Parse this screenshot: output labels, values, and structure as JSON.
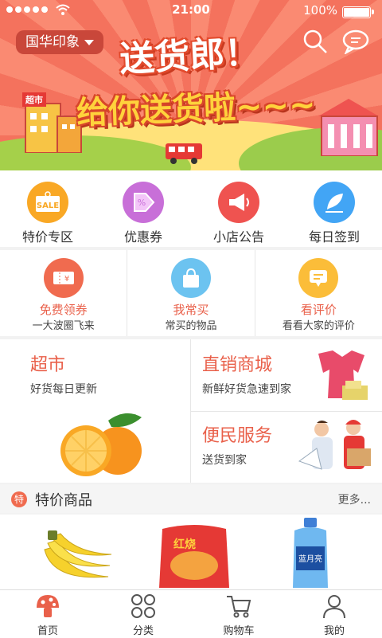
{
  "status_bar": {
    "time": "21:00",
    "battery": "100%"
  },
  "banner": {
    "location": "国华印象",
    "slogan_line1": "送货郎！",
    "slogan_line2": "给你送货啦~~~",
    "shop_sign": "超市"
  },
  "quick_nav": [
    {
      "label": "特价专区",
      "icon": "sale-tag-icon",
      "badge": "SALE",
      "color": "#f9a825"
    },
    {
      "label": "优惠券",
      "icon": "coupon-icon",
      "color": "#c86fd8"
    },
    {
      "label": "小店公告",
      "icon": "megaphone-icon",
      "color": "#ef5350"
    },
    {
      "label": "每日签到",
      "icon": "feather-pen-icon",
      "color": "#42a5f5"
    }
  ],
  "services": [
    {
      "title": "免费领券",
      "subtitle": "一大波圈飞来",
      "icon": "ticket-icon",
      "color": "#f06b4f"
    },
    {
      "title": "我常买",
      "subtitle": "常买的物品",
      "icon": "shopping-bag-icon",
      "color": "#6cc3f0"
    },
    {
      "title": "看评价",
      "subtitle": "看看大家的评价",
      "icon": "comment-icon",
      "color": "#fbbd39"
    }
  ],
  "promos": {
    "supermarket": {
      "title": "超市",
      "subtitle": "好货每日更新"
    },
    "direct_mall": {
      "title": "直销商城",
      "subtitle": "新鲜好货急速到家"
    },
    "convenience": {
      "title": "便民服务",
      "subtitle": "送货到家"
    }
  },
  "special_section": {
    "badge": "特",
    "title": "特价商品",
    "more": "更多..."
  },
  "products": [
    {
      "name": "bananas"
    },
    {
      "name": "instant-noodles",
      "label": "红烧"
    },
    {
      "name": "laundry-detergent",
      "label": "蓝月亮"
    }
  ],
  "tabbar": [
    {
      "label": "首页",
      "icon": "home-mushroom-icon",
      "active": true
    },
    {
      "label": "分类",
      "icon": "category-grid-icon"
    },
    {
      "label": "购物车",
      "icon": "cart-icon"
    },
    {
      "label": "我的",
      "icon": "user-icon"
    }
  ],
  "colors": {
    "accent": "#e9604a",
    "banner": "#f4725d"
  }
}
